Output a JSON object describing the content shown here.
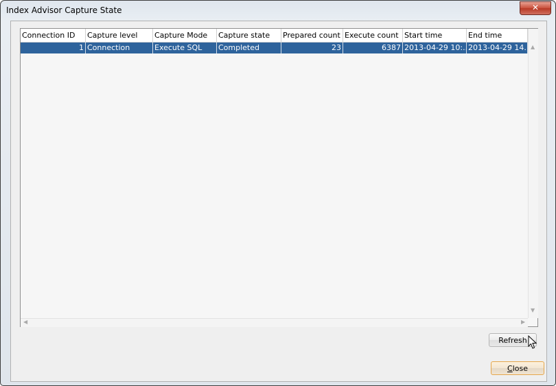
{
  "window": {
    "title": "Index Advisor Capture State",
    "close_glyph": "✕"
  },
  "table": {
    "columns": [
      "Connection ID",
      "Capture level",
      "Capture Mode",
      "Capture state",
      "Prepared count",
      "Execute count",
      "Start time",
      "End time"
    ],
    "rows": [
      {
        "selected": true,
        "cells": [
          "1",
          "Connection",
          "Execute SQL",
          "Completed",
          "23",
          "6387",
          "2013-04-29 10:...",
          "2013-04-29 14..."
        ]
      }
    ]
  },
  "buttons": {
    "refresh": "Refresh",
    "close_mnemonic": "C",
    "close_rest": "lose"
  },
  "colors": {
    "selection": "#2e639c",
    "close_button_border": "#e5a64b"
  }
}
